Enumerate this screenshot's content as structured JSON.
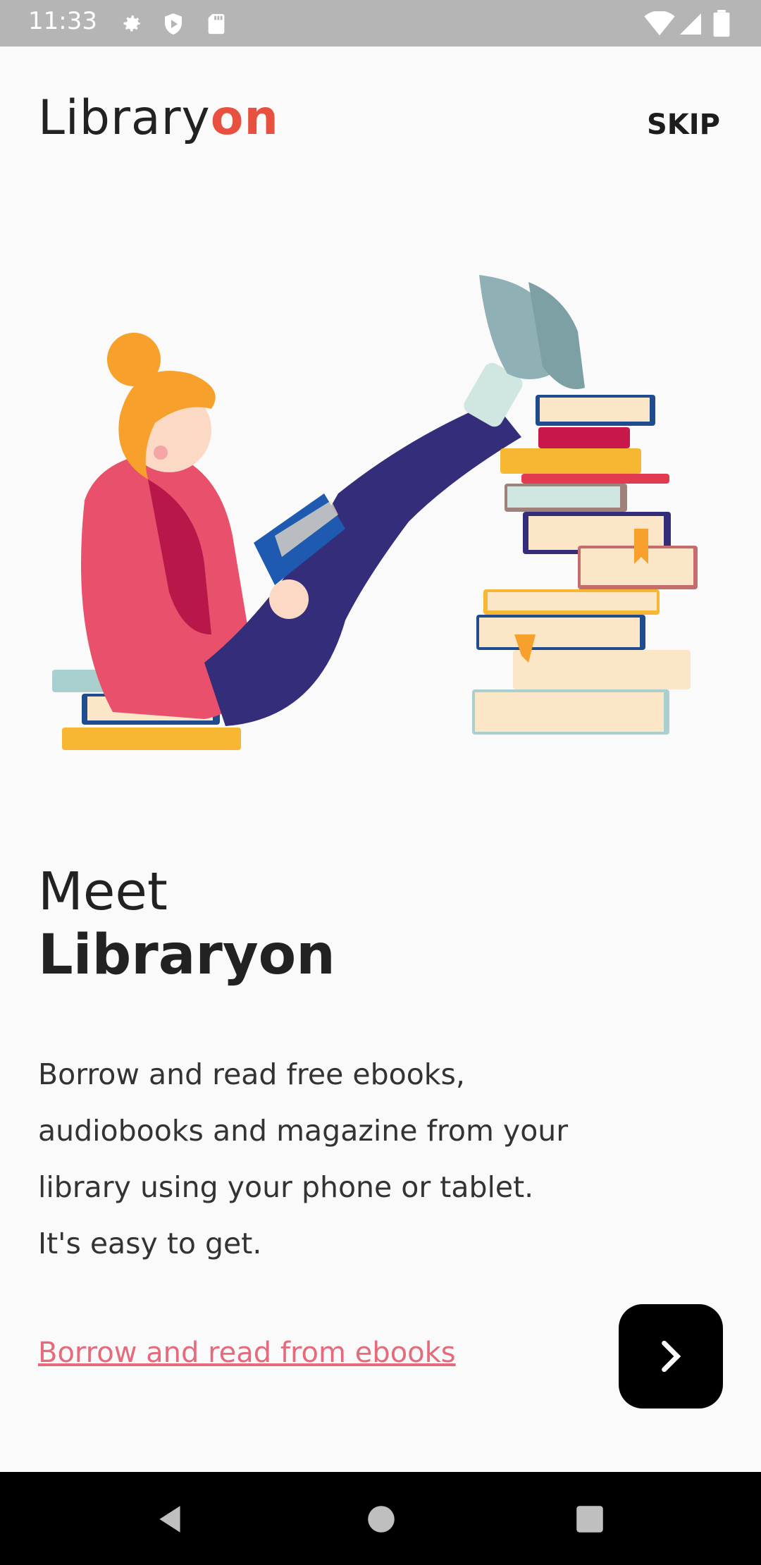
{
  "status_bar": {
    "time": "11:33",
    "icons": [
      "gear-icon",
      "play-protect-icon",
      "sd-card-icon",
      "wifi-icon",
      "signal-icon",
      "battery-icon"
    ]
  },
  "header": {
    "logo_main": "Library",
    "logo_accent": "on",
    "skip_label": "SKIP"
  },
  "hero": {
    "illustration": "woman-reading-with-book-stacks"
  },
  "content": {
    "title_light": "Meet",
    "title_bold": "Libraryon",
    "description": "Borrow and read free ebooks, audiobooks and magazine from your library using your phone or tablet. It's easy to get.",
    "link_label": "Borrow and read from ebooks"
  },
  "actions": {
    "next_icon": "chevron-right-icon"
  },
  "nav_bar": {
    "icons": [
      "back-icon",
      "home-icon",
      "recents-icon"
    ]
  },
  "colors": {
    "accent": "#e8503f",
    "link": "#e46a7c",
    "status_bar": "#b5b5b5",
    "button": "#000000"
  }
}
